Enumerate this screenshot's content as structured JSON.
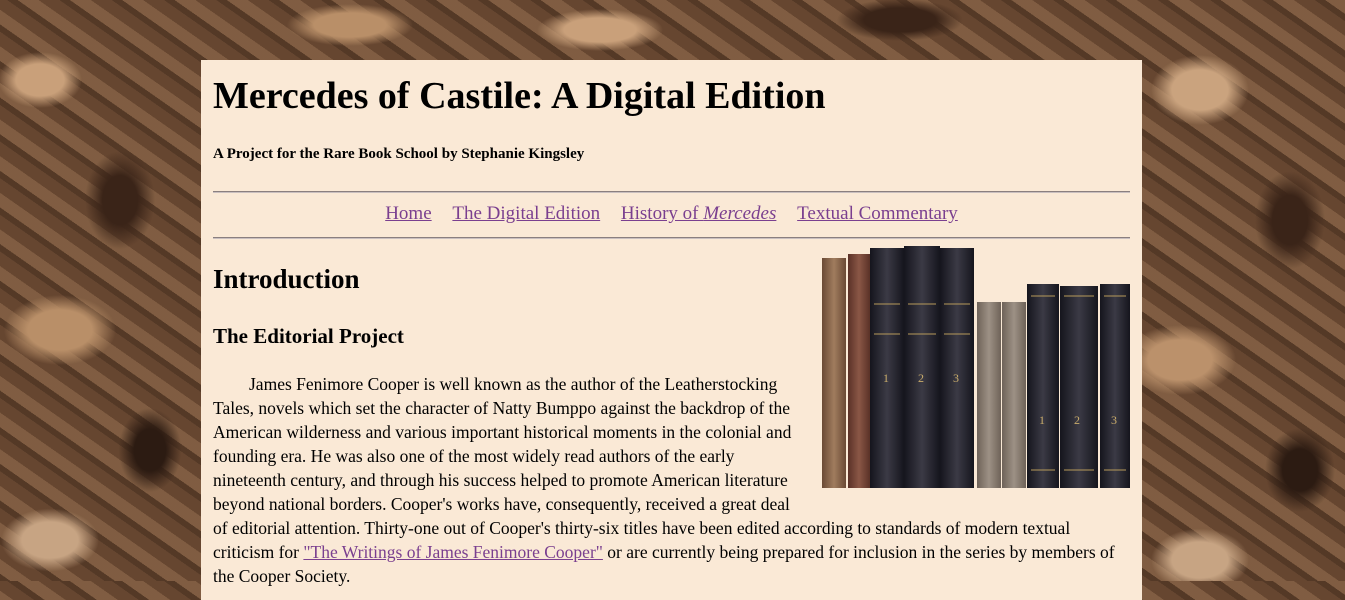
{
  "header": {
    "title": "Mercedes of Castile: A Digital Edition",
    "subtitle": "A Project for the Rare Book School by Stephanie Kingsley"
  },
  "nav": {
    "home": "Home",
    "digital_edition": "The Digital Edition",
    "history_prefix": "History of ",
    "history_italic": "Mercedes",
    "commentary": "Textual Commentary"
  },
  "main": {
    "heading": "Introduction",
    "subheading": "The Editorial Project",
    "paragraph_part1": "James Fenimore Cooper is well known as the author of the Leatherstocking Tales, novels which set the character of Natty Bumppo against the backdrop of the American wilderness and various important historical moments in the colonial and founding era. He was also one of the most widely read authors of the early nineteenth century, and through his success helped to promote American literature beyond national borders. Cooper's works have, consequently, received a great deal of editorial attention. Thirty-one out of Cooper's thirty-six titles have been edited according to standards of modern textual criticism for ",
    "link_text": "\"The Writings of James Fenimore Cooper\"",
    "paragraph_part2": " or are currently being prepared for inclusion in the series by members of the Cooper Society."
  },
  "image": {
    "books_image": "books-photo"
  }
}
